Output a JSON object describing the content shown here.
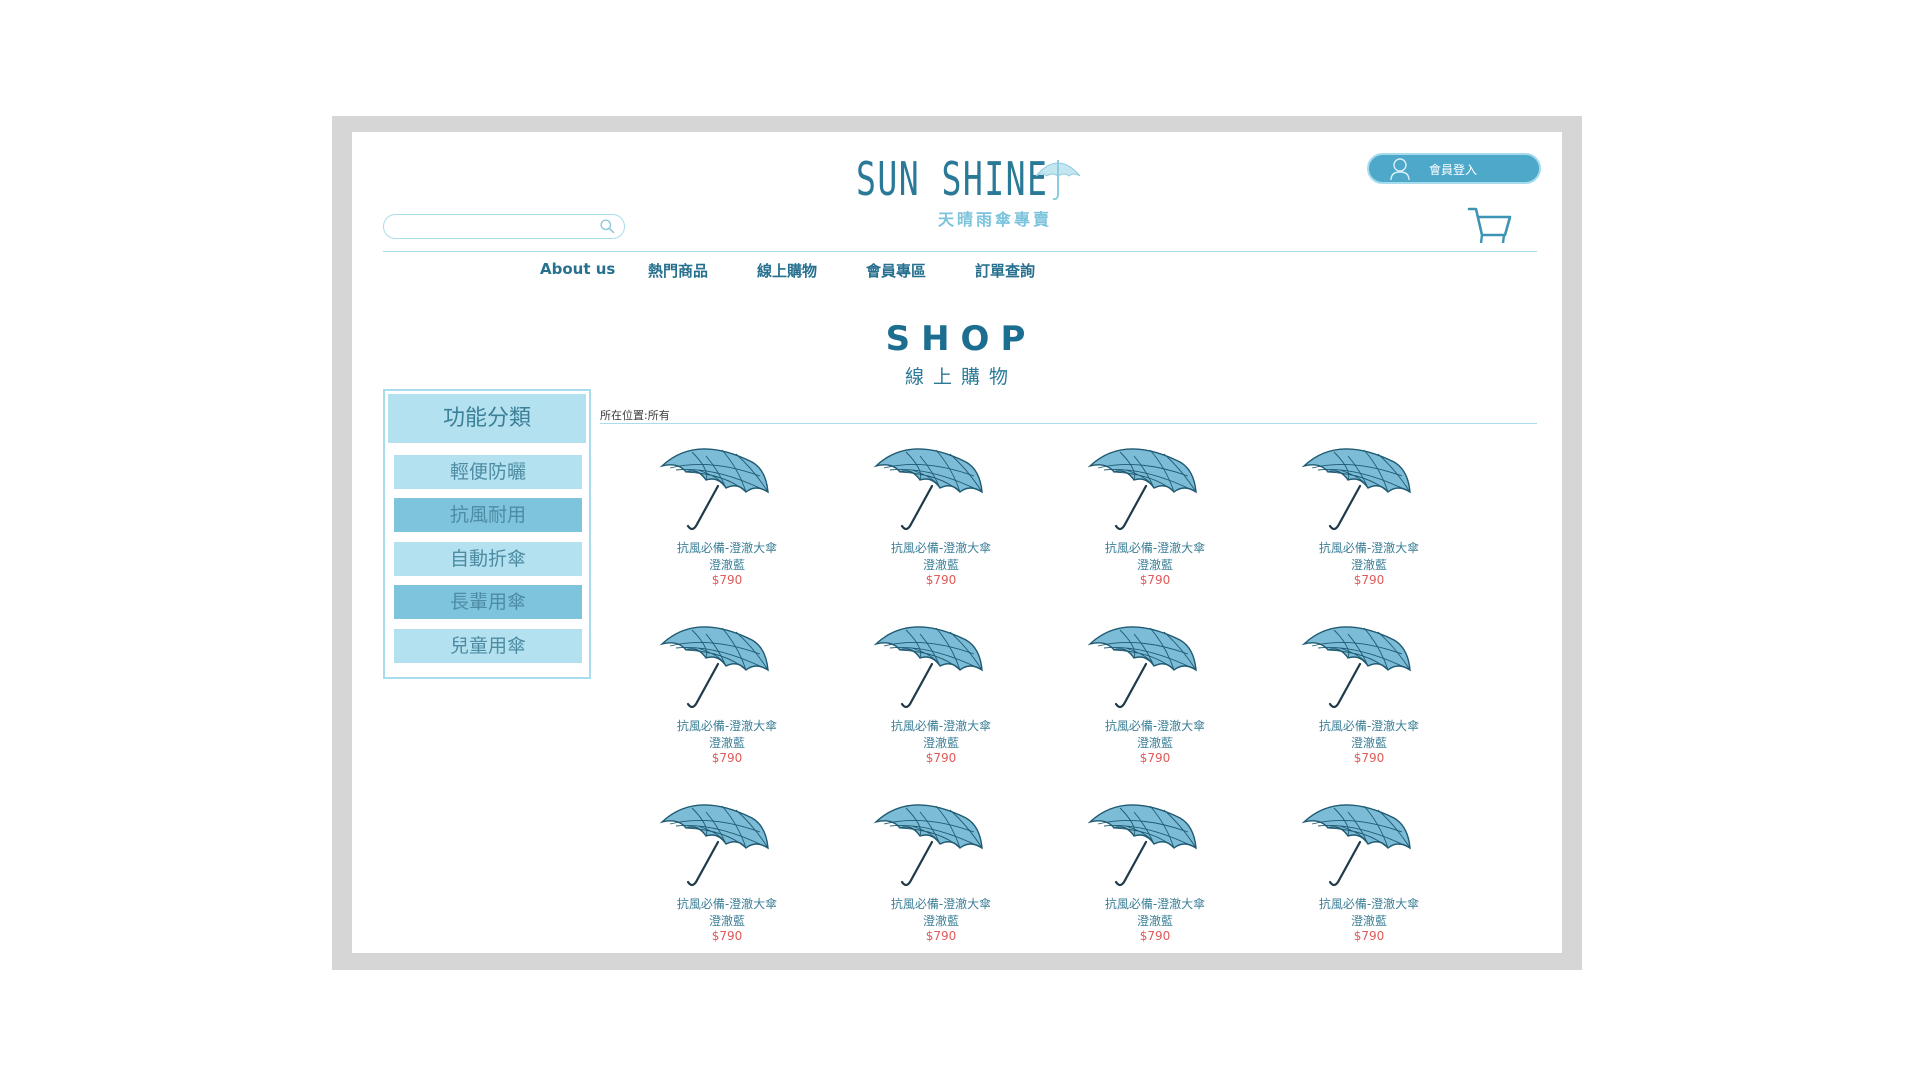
{
  "header": {
    "logo_title": "SUN SHINE",
    "logo_subtitle": "天晴雨傘專賣",
    "login_label": "會員登入",
    "search_placeholder": ""
  },
  "nav": [
    "About us",
    "熱門商品",
    "線上購物",
    "會員專區",
    "訂單查詢"
  ],
  "page": {
    "title": "SHOP",
    "subtitle": "線上購物",
    "breadcrumb": "所在位置:所有"
  },
  "sidebar": {
    "heading": "功能分類",
    "categories": [
      "輕便防曬",
      "抗風耐用",
      "自動折傘",
      "長輩用傘",
      "兒童用傘"
    ]
  },
  "products": [
    {
      "name": "抗風必備-澄澈大傘",
      "color": "澄澈藍",
      "price": "$790"
    },
    {
      "name": "抗風必備-澄澈大傘",
      "color": "澄澈藍",
      "price": "$790"
    },
    {
      "name": "抗風必備-澄澈大傘",
      "color": "澄澈藍",
      "price": "$790"
    },
    {
      "name": "抗風必備-澄澈大傘",
      "color": "澄澈藍",
      "price": "$790"
    },
    {
      "name": "抗風必備-澄澈大傘",
      "color": "澄澈藍",
      "price": "$790"
    },
    {
      "name": "抗風必備-澄澈大傘",
      "color": "澄澈藍",
      "price": "$790"
    },
    {
      "name": "抗風必備-澄澈大傘",
      "color": "澄澈藍",
      "price": "$790"
    },
    {
      "name": "抗風必備-澄澈大傘",
      "color": "澄澈藍",
      "price": "$790"
    },
    {
      "name": "抗風必備-澄澈大傘",
      "color": "澄澈藍",
      "price": "$790"
    },
    {
      "name": "抗風必備-澄澈大傘",
      "color": "澄澈藍",
      "price": "$790"
    },
    {
      "name": "抗風必備-澄澈大傘",
      "color": "澄澈藍",
      "price": "$790"
    },
    {
      "name": "抗風必備-澄澈大傘",
      "color": "澄澈藍",
      "price": "$790"
    }
  ],
  "icons": {
    "search": "search-icon",
    "user": "user-icon",
    "cart": "cart-icon",
    "product_image": "umbrella-icon"
  },
  "colors": {
    "accent": "#4ea8c9",
    "light_accent": "#b4e1ef",
    "text": "#1c6e90",
    "price": "#e05a5a",
    "frame": "#d6d6d6"
  }
}
